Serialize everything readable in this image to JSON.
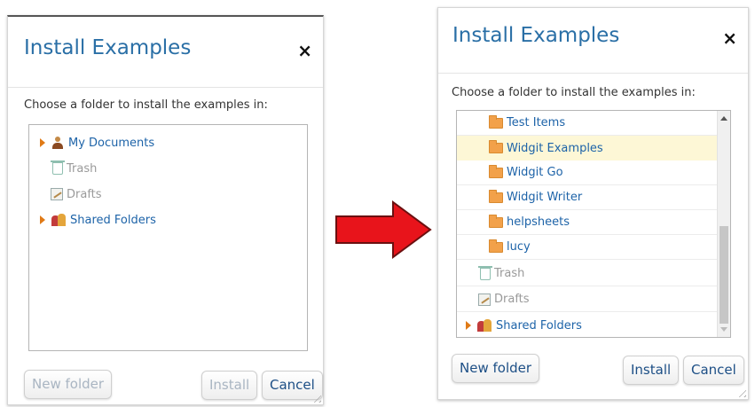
{
  "before_dialog": {
    "title": "Install Examples",
    "close_symbol": "×",
    "prompt": "Choose a folder to install the examples in:",
    "tree": [
      {
        "label": "My Documents",
        "icon": "person-icon",
        "expandable": true,
        "state": "normal"
      },
      {
        "label": "Trash",
        "icon": "trash-icon",
        "expandable": false,
        "state": "disabled"
      },
      {
        "label": "Drafts",
        "icon": "drafts-icon",
        "expandable": false,
        "state": "disabled"
      },
      {
        "label": "Shared Folders",
        "icon": "shared-folders-icon",
        "expandable": true,
        "state": "normal"
      }
    ],
    "buttons": {
      "new_folder": "New folder",
      "install": "Install",
      "cancel": "Cancel"
    },
    "install_enabled": false,
    "new_folder_enabled": false
  },
  "after_dialog": {
    "title": "Install Examples",
    "close_symbol": "×",
    "prompt": "Choose a folder to install the examples in:",
    "tree": [
      {
        "label": "Test Items",
        "icon": "folder-icon",
        "state": "normal"
      },
      {
        "label": "Widgit Examples",
        "icon": "folder-icon",
        "state": "selected"
      },
      {
        "label": "Widgit Go",
        "icon": "folder-icon",
        "state": "normal"
      },
      {
        "label": "Widgit Writer",
        "icon": "folder-icon",
        "state": "normal"
      },
      {
        "label": "helpsheets",
        "icon": "folder-icon",
        "state": "normal"
      },
      {
        "label": "lucy",
        "icon": "folder-icon",
        "state": "normal"
      },
      {
        "label": "Trash",
        "icon": "trash-icon",
        "state": "disabled"
      },
      {
        "label": "Drafts",
        "icon": "drafts-icon",
        "state": "disabled"
      },
      {
        "label": "Shared Folders",
        "icon": "shared-folders-icon",
        "expandable": true,
        "state": "normal"
      }
    ],
    "buttons": {
      "new_folder": "New folder",
      "install": "Install",
      "cancel": "Cancel"
    },
    "install_enabled": true,
    "new_folder_enabled": true
  },
  "colors": {
    "title": "#2a6fa6",
    "link_text": "#1d63a8",
    "disabled_text": "#9a9a9a",
    "selected_row": "#fdf7d6",
    "folder": "#f2a14a",
    "expander": "#e07a16",
    "arrow": "#e8141b"
  }
}
